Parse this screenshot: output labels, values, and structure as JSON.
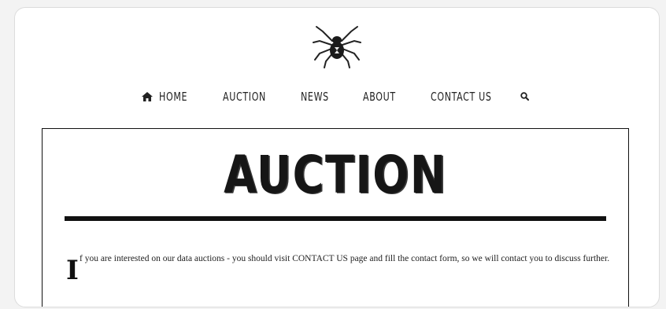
{
  "nav": {
    "items": [
      {
        "label": "HOME",
        "icon": "home-icon"
      },
      {
        "label": "AUCTION"
      },
      {
        "label": "NEWS"
      },
      {
        "label": "ABOUT"
      },
      {
        "label": "CONTACT US"
      }
    ],
    "search_icon": "search-icon"
  },
  "logo": {
    "icon": "spider-logo-icon"
  },
  "main": {
    "title": "AUCTION",
    "drop_cap": "I",
    "body": "f you are interested on our data auctions - you should visit CONTACT US page and fill the contact form, so we will contact you to discuss further."
  }
}
